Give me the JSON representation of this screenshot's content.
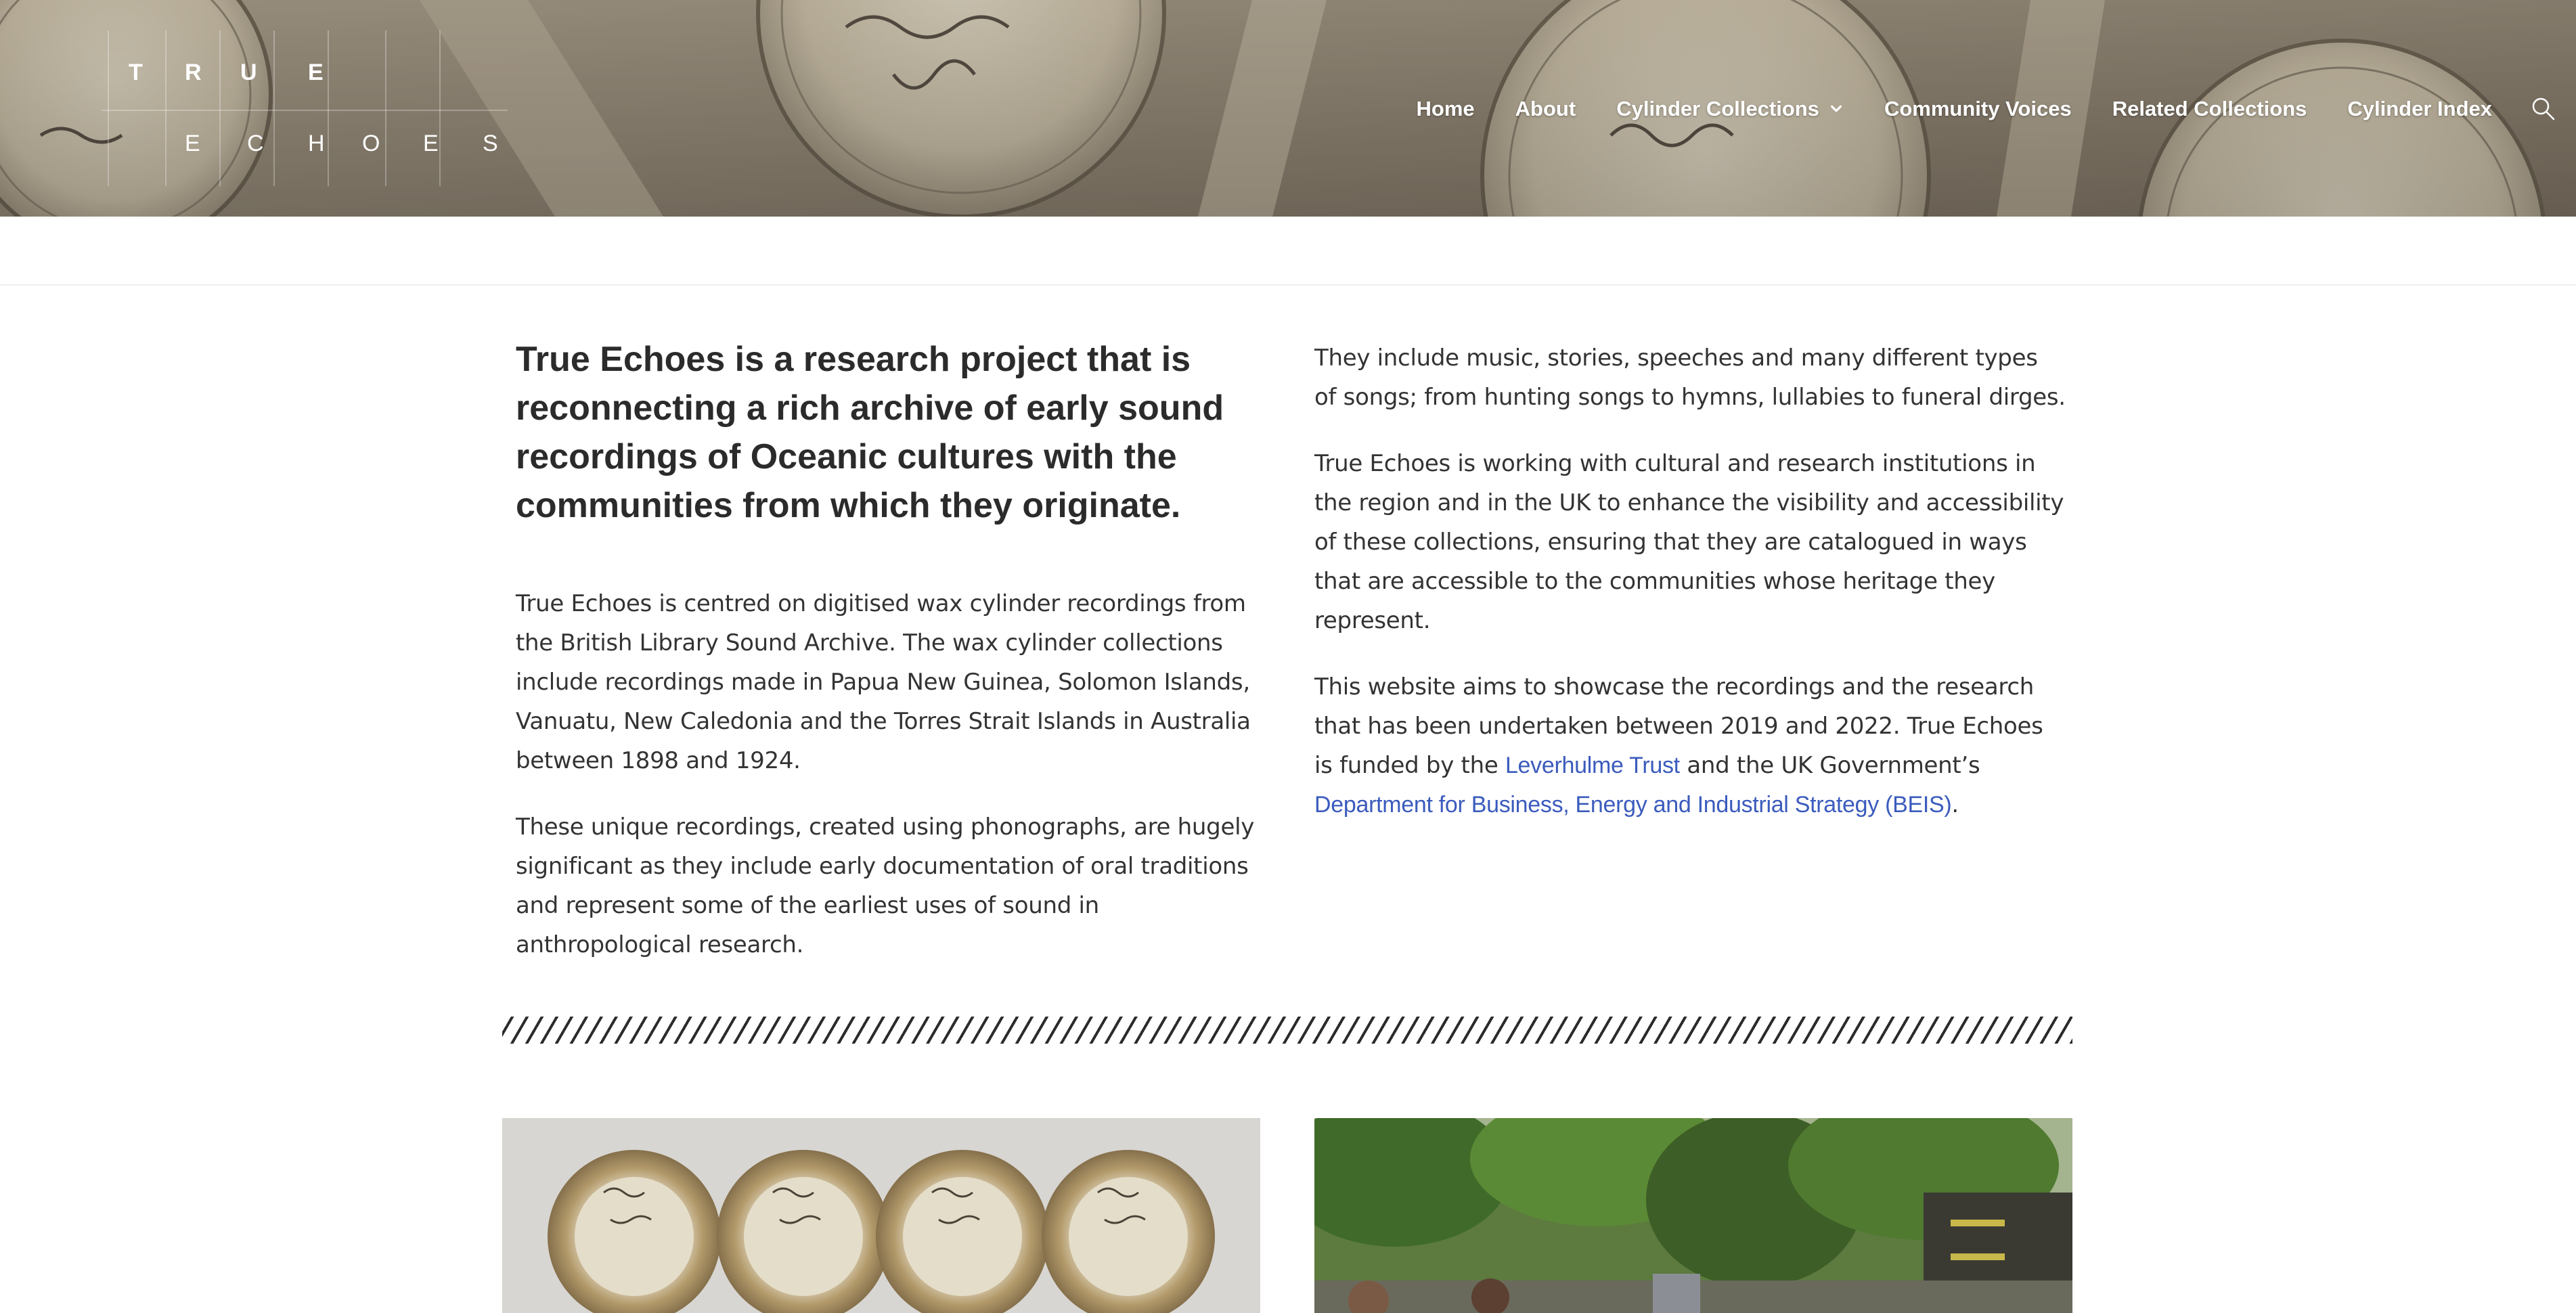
{
  "logo": {
    "row1": [
      "T",
      "R",
      "U",
      "E"
    ],
    "row2": [
      "E",
      "C",
      "H",
      "O",
      "E",
      "S"
    ]
  },
  "nav": {
    "items": [
      {
        "label": "Home"
      },
      {
        "label": "About"
      },
      {
        "label": "Cylinder Collections",
        "has_dropdown": true
      },
      {
        "label": "Community Voices"
      },
      {
        "label": "Related Collections"
      },
      {
        "label": "Cylinder Index"
      }
    ],
    "search_icon": "search-icon"
  },
  "intro": {
    "lead": "True Echoes is a research project that is reconnecting a rich archive of early sound recordings of Oceanic cultures with the communities from which they originate.",
    "para1": "True Echoes is centred on digitised wax cylinder recordings from the British Library Sound Archive. The wax cylinder collections include recordings made in Papua New Guinea, Solomon Islands, Vanuatu, New Caledonia and the Torres Strait Islands in Australia between 1898 and 1924.",
    "para2": "These unique recordings, created using phonographs, are hugely significant as they include early documentation of oral traditions and represent some of the earliest uses of sound in anthropological research.",
    "para3": "They include music, stories, speeches and many different types of songs; from hunting songs to hymns, lullabies to funeral dirges.",
    "para4": "True Echoes is working with cultural and research institutions in the region and in the UK to enhance the visibility and accessibility of these collections, ensuring that they are catalogued in ways that are accessible to the communities whose heritage they represent.",
    "para5_a": "This website aims to showcase the recordings and the research that has been undertaken between 2019 and 2022. True Echoes is funded by the ",
    "link1": "Leverhulme Trust",
    "para5_b": " and the UK Government’s ",
    "link2": "Department for Business, Energy and Industrial Strategy (BEIS)",
    "para5_c": "."
  },
  "colors": {
    "link": "#3b5bbd",
    "text": "#333333",
    "heading": "#2b2b2b"
  }
}
